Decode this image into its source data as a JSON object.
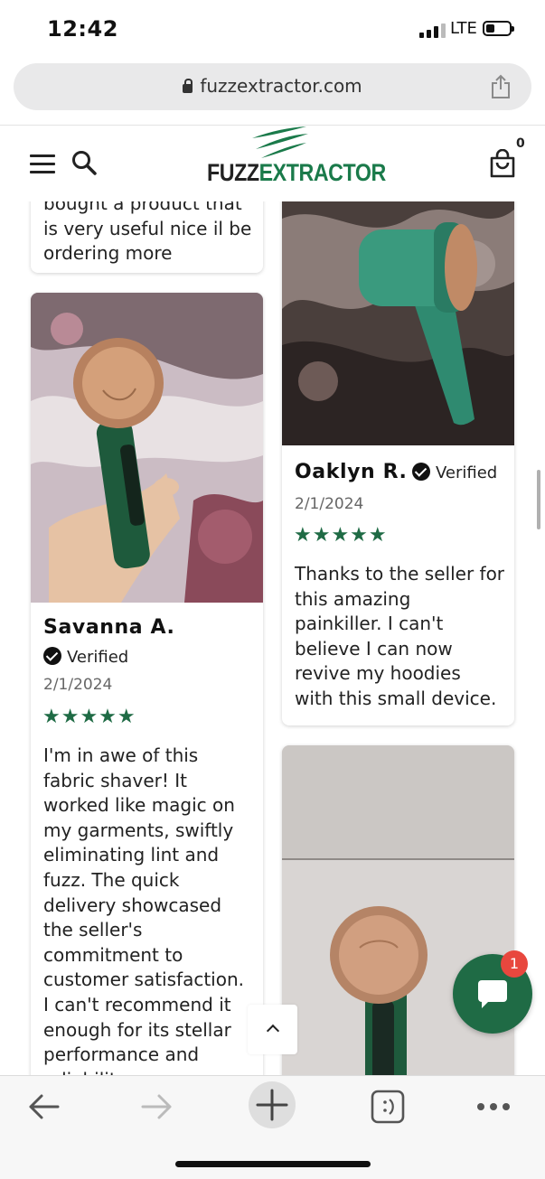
{
  "status_bar": {
    "time": "12:42",
    "network": "LTE"
  },
  "browser": {
    "url": "fuzzextractor.com"
  },
  "header": {
    "logo_part1": "FUZZ",
    "logo_part2": "EXTRACTOR",
    "cart_count": "0"
  },
  "reviews": [
    {
      "text_partial": "bought a product that",
      "text_lines": [
        "is very useful nice il be",
        "ordering more"
      ]
    },
    {
      "name": "Savanna A.",
      "verified": "Verified",
      "date": "2/1/2024",
      "stars": "★★★★★",
      "text_lines": [
        "I'm in awe of this",
        "fabric shaver! It",
        "worked like magic on",
        "my garments, swiftly",
        "eliminating lint and",
        "fuzz. The quick",
        "delivery showcased",
        "the seller's",
        "commitment to",
        "customer satisfaction.",
        "I can't recommend it",
        "enough for its stellar",
        "performance and",
        "reliability."
      ]
    },
    {
      "name": "Oaklyn R.",
      "verified": "Verified",
      "date": "2/1/2024",
      "stars": "★★★★★",
      "text_lines": [
        "Thanks to the seller for",
        "this amazing",
        "painkiller. I can't",
        "believe I can now",
        "revive my hoodies",
        "with this small device."
      ]
    }
  ],
  "chat": {
    "badge": "1"
  },
  "colors": {
    "brand_green": "#1f6b45",
    "badge_red": "#e8473e"
  }
}
